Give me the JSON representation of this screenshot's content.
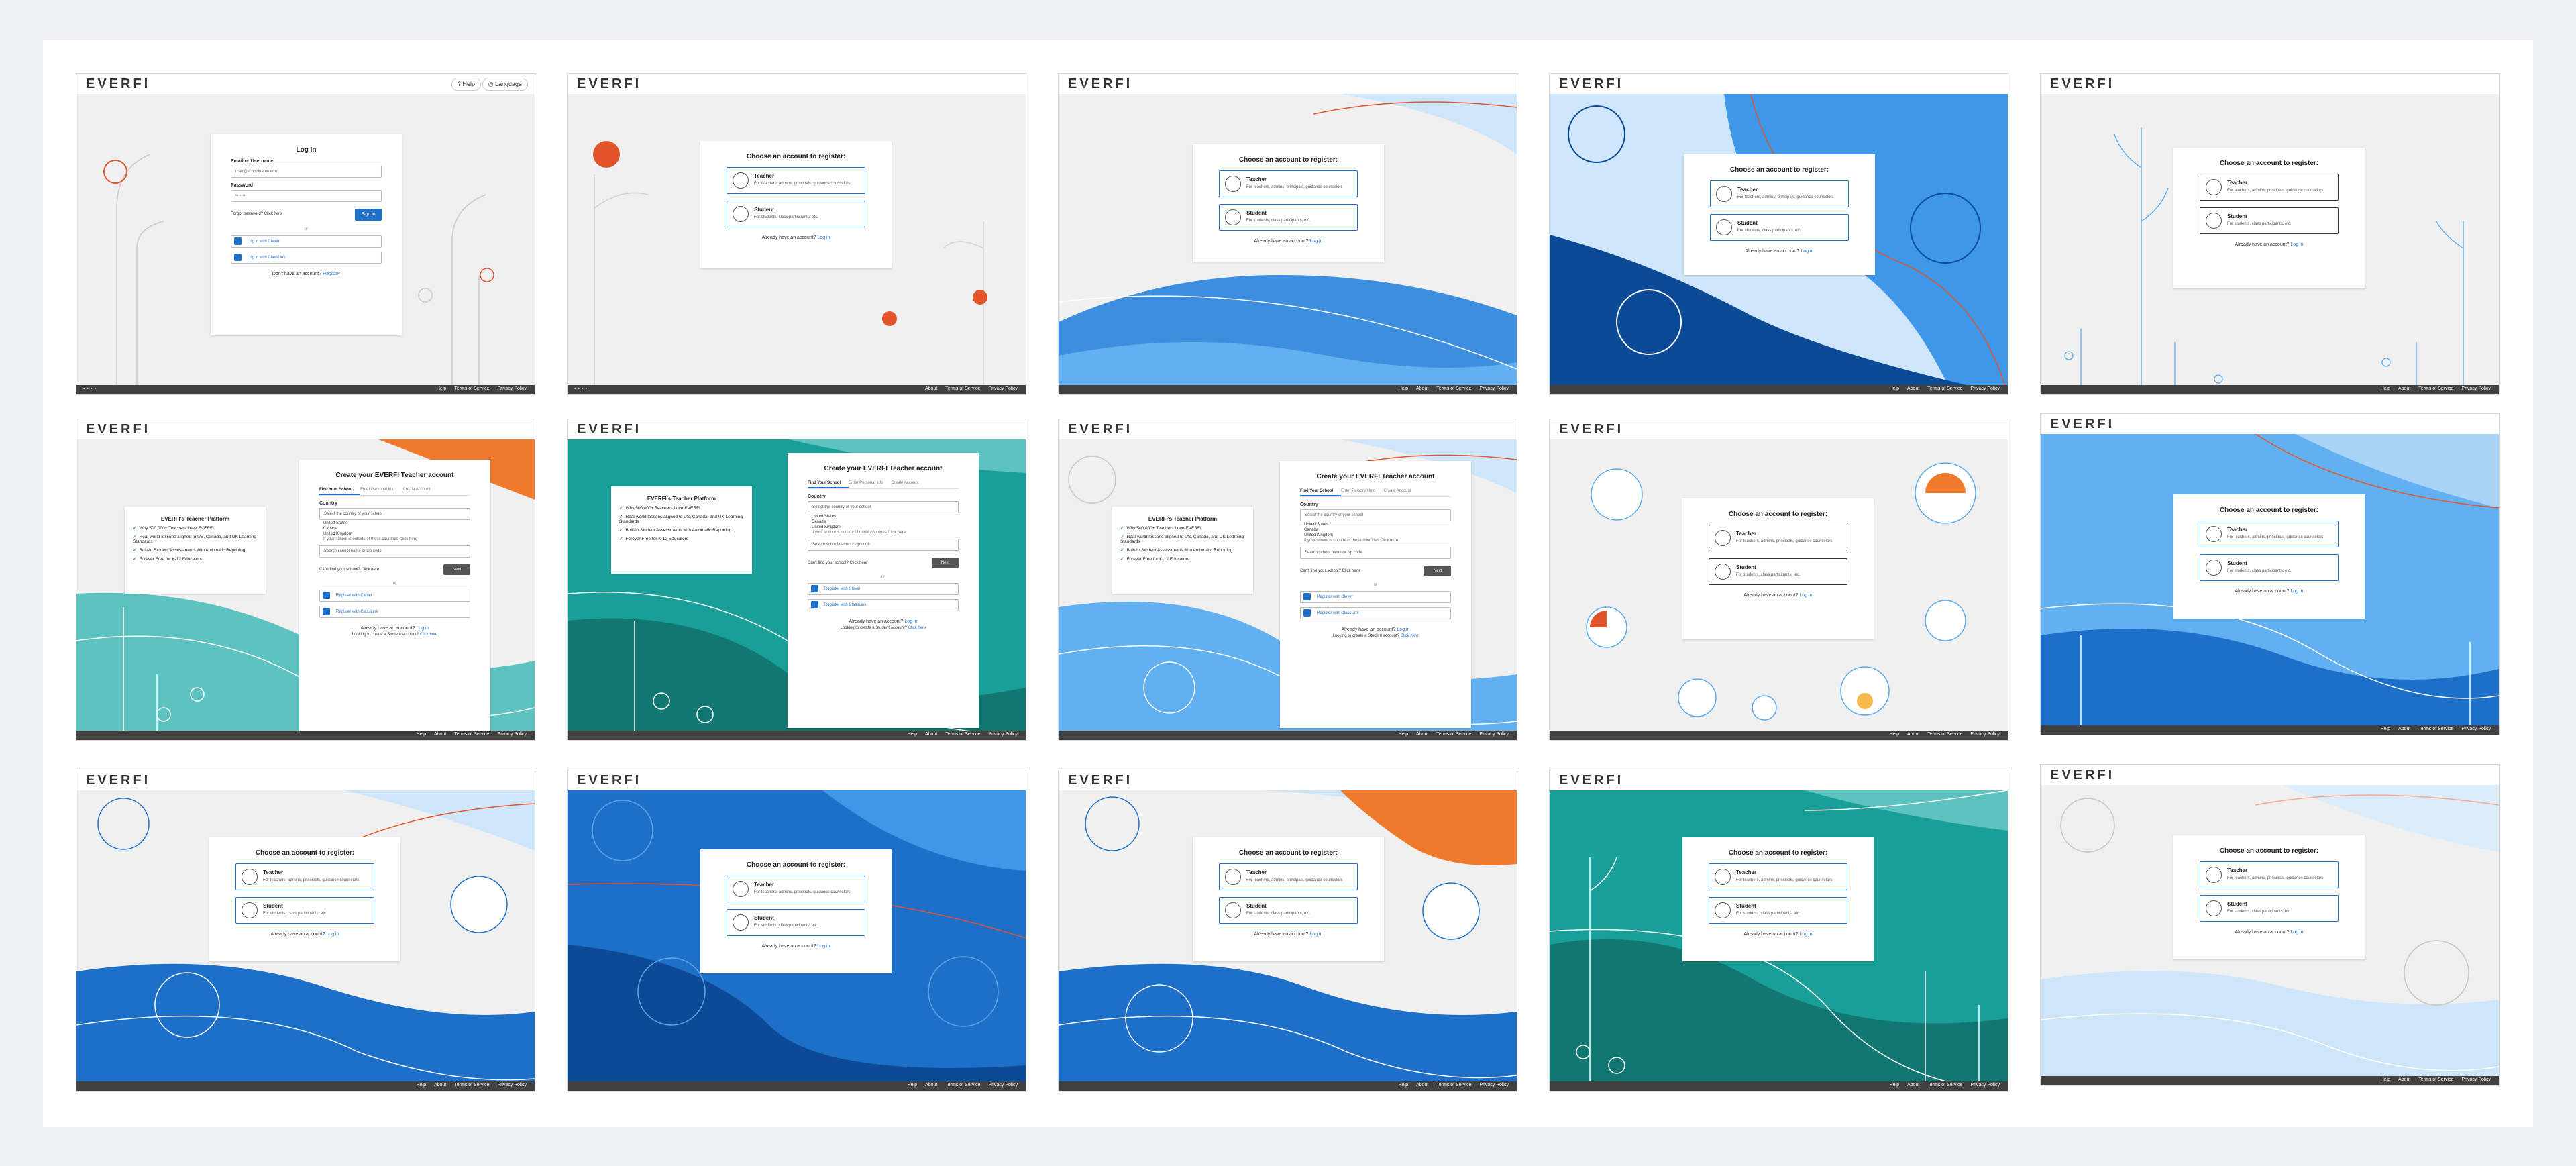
{
  "brand": {
    "logo": "EVERFI"
  },
  "header": {
    "help": "Help",
    "language": "Language"
  },
  "footer": {
    "links": [
      "Help",
      "About",
      "Terms of Service",
      "Privacy Policy"
    ]
  },
  "login": {
    "title": "Log In",
    "email_label": "Email or Username",
    "email_value": "user@schoolname.edu",
    "password_label": "Password",
    "password_value": "••••••••",
    "forgot": "Forgot password? Click here",
    "signin": "Sign in",
    "or": "or",
    "clever": "Log in with Clever",
    "classlink": "Log in with ClassLink",
    "no_account": "Don't have an account?",
    "register": "Register"
  },
  "choose": {
    "title": "Choose an account to register:",
    "teacher": "Teacher",
    "teacher_desc": "For teachers, admins, principals, guidance counselors",
    "student": "Student",
    "student_desc": "For students, class participants, etc.",
    "have_account": "Already have an account?",
    "login": "Log in"
  },
  "create": {
    "title": "Create your EVERFI Teacher account",
    "tabs": [
      "Find Your School",
      "Enter Personal Info",
      "Create Account"
    ],
    "country_label": "Country",
    "country_placeholder": "Select the country of your school",
    "countries": [
      "United States",
      "Canada",
      "United Kingdom"
    ],
    "hint": "If your school is outside of these countries Click here",
    "school_placeholder": "Search school name or zip code",
    "cant_find": "Can't find your school? Click here",
    "next": "Next",
    "or": "or",
    "clever": "Register with Clever",
    "classlink": "Register with ClassLink",
    "have_account": "Already have an account?",
    "login": "Log in",
    "student_q": "Looking to create a Student account?",
    "student_link": "Click here"
  },
  "platform": {
    "title": "EVERFI's Teacher Platform",
    "bullets": [
      "Why 500,000+ Teachers Love EVERFI",
      "Real-world lessons aligned to US, Canada, and UK Learning Standards",
      "Built-in Student Assessments with Automatic Reporting",
      "Forever Free for K-12 Educators"
    ]
  },
  "colors": {
    "accent": "#1d6fc8",
    "orange": "#e2552b",
    "teal": "#1a9e98",
    "navy": "#0d4a95",
    "light_blue": "#62b0f0"
  }
}
